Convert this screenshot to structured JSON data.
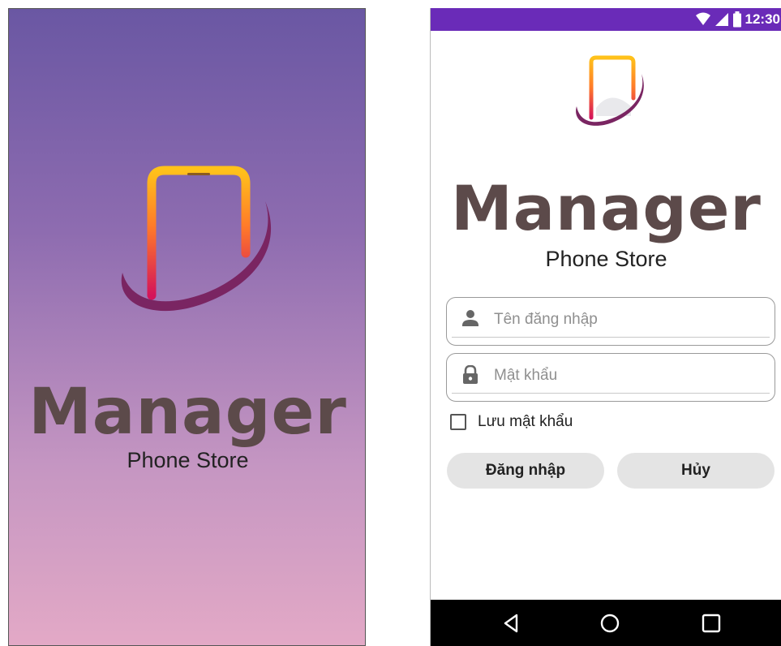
{
  "splash": {
    "brand": "Manager",
    "subtitle": "Phone Store",
    "logo_icon": "phone-swoosh-logo",
    "colors": {
      "gradient_top": "#6a57a3",
      "gradient_bottom": "#e3a9c6",
      "brand_text": "#5c4a4a"
    }
  },
  "login": {
    "status_bar": {
      "time": "12:30",
      "icons": [
        "wifi-icon",
        "signal-icon",
        "battery-icon"
      ],
      "color": "#6a2bb8"
    },
    "brand": "Manager",
    "subtitle": "Phone Store",
    "username": {
      "placeholder": "Tên đăng nhập",
      "value": "",
      "icon": "person-icon"
    },
    "password": {
      "placeholder": "Mật khẩu",
      "value": "",
      "icon": "lock-icon"
    },
    "remember": {
      "label": "Lưu mật khẩu",
      "checked": false
    },
    "buttons": {
      "login": "Đăng nhập",
      "cancel": "Hủy"
    },
    "nav_bar": [
      "back-icon",
      "home-icon",
      "recents-icon"
    ]
  }
}
